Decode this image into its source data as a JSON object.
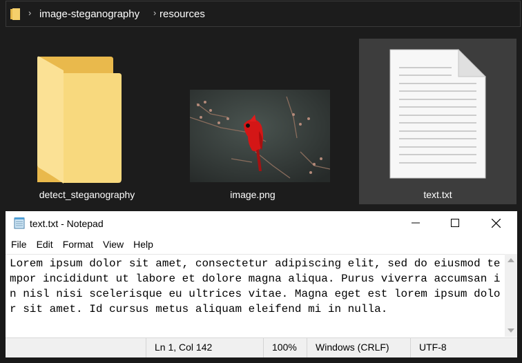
{
  "explorer": {
    "breadcrumb": [
      "image-steganography",
      "resources"
    ],
    "items": [
      {
        "name": "detect_steganography",
        "type": "folder"
      },
      {
        "name": "image.png",
        "type": "image"
      },
      {
        "name": "text.txt",
        "type": "text-file",
        "selected": true
      }
    ]
  },
  "notepad": {
    "title": "text.txt - Notepad",
    "menu": [
      "File",
      "Edit",
      "Format",
      "View",
      "Help"
    ],
    "content": "Lorem ipsum dolor sit amet, consectetur adipiscing elit, sed do eiusmod tempor incididunt ut labore et dolore magna aliqua. Purus viverra accumsan in nisl nisi scelerisque eu ultrices vitae. Magna eget est lorem ipsum dolor sit amet. Id cursus metus aliquam eleifend mi in nulla.",
    "status": {
      "position": "Ln 1, Col 142",
      "zoom": "100%",
      "line_ending": "Windows (CRLF)",
      "encoding": "UTF-8"
    }
  },
  "colors": {
    "folder": "#f5cf6b",
    "cardinal": "#d41616",
    "selection": "#3d3d3d"
  }
}
